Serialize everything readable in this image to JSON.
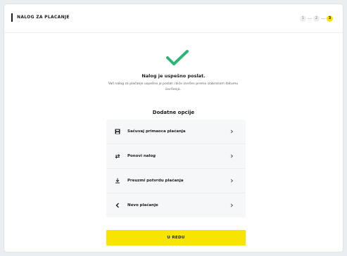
{
  "header": {
    "title": "NALOG ZA PLACANJE",
    "steps": [
      {
        "label": "1"
      },
      {
        "label": "2"
      },
      {
        "label": "3"
      }
    ]
  },
  "result": {
    "title": "Nalog je uspešno poslat.",
    "description": "Vaš nalog za plaćanje uspešno je poslat i biće izvršen prema izabranom datumu izvršenja."
  },
  "options": {
    "title": "Dodatne opcije",
    "items": [
      {
        "label": "Sačuvaj primaoca plaćanja",
        "icon": "save-icon"
      },
      {
        "label": "Ponovi nalog",
        "icon": "repeat-icon"
      },
      {
        "label": "Preuzmi potvrdu plaćanja",
        "icon": "download-icon"
      },
      {
        "label": "Novo plaćanje",
        "icon": "chevron-left-icon"
      }
    ]
  },
  "footer": {
    "ok_label": "U REDU"
  },
  "colors": {
    "accent": "#f7e500",
    "success": "#2bb673"
  }
}
